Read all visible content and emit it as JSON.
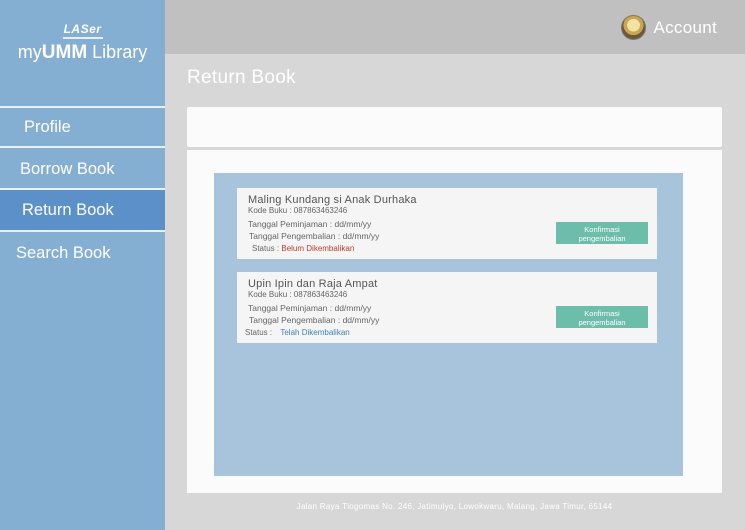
{
  "brand": {
    "top": "LASer",
    "main_prefix": "my",
    "main_bold": "UMM",
    "main_suffix": " Library"
  },
  "sidebar": {
    "items": [
      {
        "label": "Profile",
        "active": false
      },
      {
        "label": "Borrow Book",
        "active": false
      },
      {
        "label": "Return Book",
        "active": true
      },
      {
        "label": "Search Book",
        "active": false
      }
    ]
  },
  "header": {
    "account_label": "Account",
    "avatar_icon": "user-avatar-icon"
  },
  "main": {
    "title": "Return Book",
    "books": [
      {
        "title": "Maling Kundang si Anak Durhaka",
        "code": "Kode Buku : 087863463246",
        "borrow_date": "Tanggal Peminjaman : dd/mm/yy",
        "return_date": "Tanggal Pengembalian : dd/mm/yy",
        "status_label": "Status : ",
        "status_value": "Belum Dikembalikan",
        "status_color": "#c0392b",
        "button_line1": "Konfirmasi",
        "button_line2": "pengembalian"
      },
      {
        "title": "Upin Ipin dan Raja Ampat",
        "code": "Kode Buku : 087863463246",
        "borrow_date": "Tanggal Peminjaman : dd/mm/yy",
        "return_date": "Tanggal Pengembalian : dd/mm/yy",
        "status_label": "Status :",
        "status_value": "Telah Dikembalikan",
        "status_color": "#3f80b8",
        "button_line1": "Konfirmasi",
        "button_line2": "pengembalian"
      }
    ]
  },
  "footer": {
    "address": "Jalan Raya Tlogomas No. 246, Jatimulyo, Lowokwaru, Malang, Jawa Timur, 65144"
  },
  "colors": {
    "sidebar": "#85aed3",
    "active": "#5b90c9",
    "topbar": "#c0c0c0",
    "panel": "#a8c4dc",
    "button": "#6dbdab"
  }
}
